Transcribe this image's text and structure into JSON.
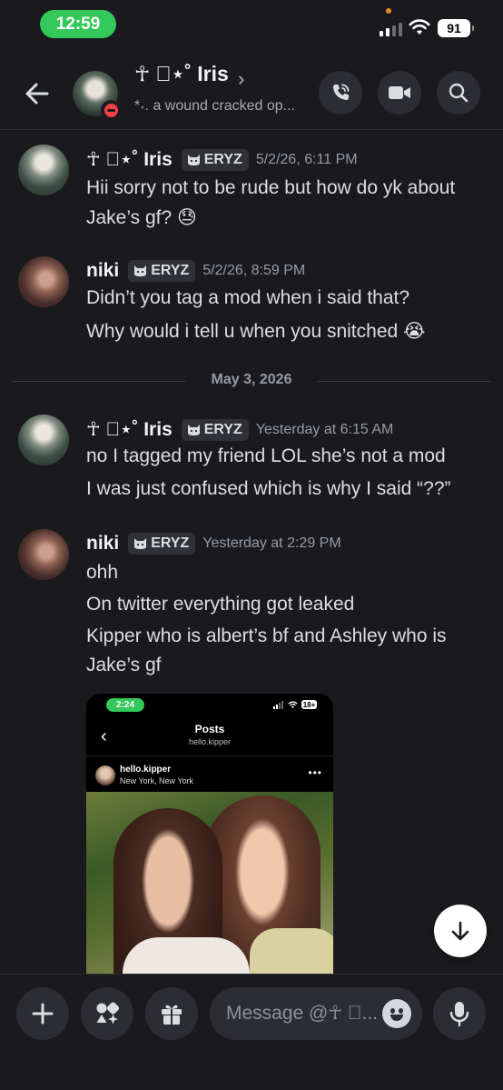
{
  "status_bar": {
    "time": "12:59",
    "battery": "91"
  },
  "header": {
    "back_label": "Back",
    "name": "☥ ⃝⋆˚ Iris",
    "chevron": "›",
    "status": "*˖. a wound cracked op..."
  },
  "messages": [
    {
      "author": "☥ ⃝⋆˚ Iris",
      "tag": "ERYZ",
      "timestamp": "5/2/26, 6:11 PM",
      "lines": [
        "Hii sorry not to be rude but how do yk about",
        "Jake’s gf? 😓"
      ]
    },
    {
      "author": "niki",
      "tag": "ERYZ",
      "timestamp": "5/2/26, 8:59 PM",
      "lines": [
        "Didn’t you tag a mod when i said that?",
        "Why would i tell u when you snitched 😭"
      ]
    },
    {
      "author": "☥ ⃝⋆˚ Iris",
      "tag": "ERYZ",
      "timestamp": "Yesterday at 6:15 AM",
      "lines": [
        "no I tagged my friend LOL she’s not a mod",
        "I was just confused which is why I said “??”"
      ]
    },
    {
      "author": "niki",
      "tag": "ERYZ",
      "timestamp": "Yesterday at 2:29 PM",
      "lines": [
        "ohh",
        "On twitter everything got leaked",
        "Kipper who is albert’s bf and Ashley who is",
        "Jake’s gf"
      ]
    }
  ],
  "date_separator": "May 3, 2026",
  "attachment": {
    "time": "2:24",
    "battery": "18+",
    "title": "Posts",
    "subtitle": "hello.kipper",
    "username": "hello.kipper",
    "location": "New York, New York",
    "more": "•••"
  },
  "composer": {
    "placeholder": "Message @☥ ⃝..."
  },
  "colors": {
    "accent_green": "#34c759",
    "background": "#1a1a1e",
    "button_bg": "#2b2d33",
    "dnd_red": "#f23f43"
  }
}
